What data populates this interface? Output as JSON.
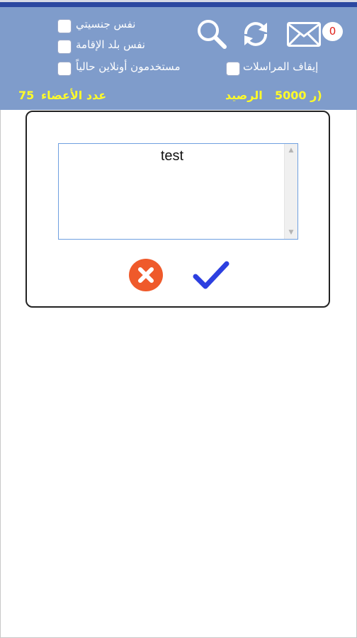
{
  "header": {
    "message_count": "0",
    "checkboxes": {
      "same_nationality": "نفس جنسيتي",
      "same_country": "نفس بلد الإقامة",
      "online_now": "مستخدمون أونلاين حالياً",
      "stop_messages": "إيقاف المراسلات"
    },
    "members_label": "عدد الأعضاء",
    "members_count": "75",
    "balance_label": "الرصيد",
    "balance_value": "(ر 5000"
  },
  "dialog": {
    "text_value": "test"
  },
  "colors": {
    "header_bg": "#7f9ccb",
    "top_bar": "#2b47a0",
    "balance_text": "#fffb2a",
    "cancel_button": "#ef5a2b",
    "confirm_check": "#2c3fe0"
  },
  "icons": [
    "mail-icon",
    "refresh-icon",
    "search-icon",
    "close-icon",
    "checkmark-icon",
    "scroll-up-icon",
    "scroll-down-icon"
  ]
}
